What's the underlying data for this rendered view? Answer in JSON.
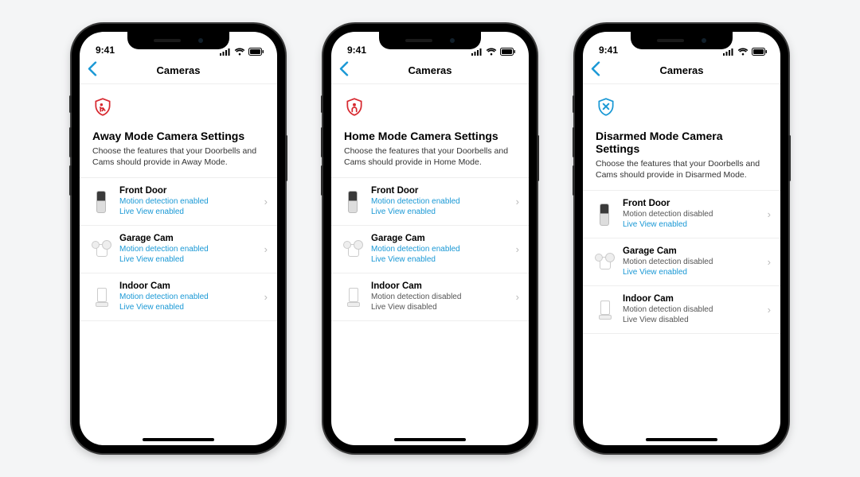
{
  "status": {
    "time": "9:41"
  },
  "nav": {
    "title": "Cameras"
  },
  "colors": {
    "accent": "#1998d5",
    "away": "#d7282f",
    "home": "#d7282f",
    "disarmed": "#1998d5"
  },
  "phones": [
    {
      "icon": "away",
      "title": "Away Mode Camera Settings",
      "desc": "Choose the features that your Doorbells and Cams should provide in Away Mode.",
      "devices": [
        {
          "name": "Front Door",
          "thumb": "doorbell",
          "motion": {
            "text": "Motion detection enabled",
            "on": true
          },
          "live": {
            "text": "Live View enabled",
            "on": true
          }
        },
        {
          "name": "Garage Cam",
          "thumb": "spotlight",
          "motion": {
            "text": "Motion detection enabled",
            "on": true
          },
          "live": {
            "text": "Live View enabled",
            "on": true
          }
        },
        {
          "name": "Indoor Cam",
          "thumb": "indoor",
          "motion": {
            "text": "Motion detection enabled",
            "on": true
          },
          "live": {
            "text": "Live View enabled",
            "on": true
          }
        }
      ]
    },
    {
      "icon": "home",
      "title": "Home Mode Camera Settings",
      "desc": "Choose the features that your Doorbells and Cams should provide in Home Mode.",
      "devices": [
        {
          "name": "Front Door",
          "thumb": "doorbell",
          "motion": {
            "text": "Motion detection enabled",
            "on": true
          },
          "live": {
            "text": "Live View enabled",
            "on": true
          }
        },
        {
          "name": "Garage Cam",
          "thumb": "spotlight",
          "motion": {
            "text": "Motion detection enabled",
            "on": true
          },
          "live": {
            "text": "Live View enabled",
            "on": true
          }
        },
        {
          "name": "Indoor Cam",
          "thumb": "indoor",
          "motion": {
            "text": "Motion detection disabled",
            "on": false
          },
          "live": {
            "text": "Live View disabled",
            "on": false
          }
        }
      ]
    },
    {
      "icon": "disarmed",
      "title": "Disarmed Mode Camera Settings",
      "desc": "Choose the features that your Doorbells and Cams should provide in Disarmed Mode.",
      "devices": [
        {
          "name": "Front Door",
          "thumb": "doorbell",
          "motion": {
            "text": "Motion detection disabled",
            "on": false
          },
          "live": {
            "text": "Live View enabled",
            "on": true
          }
        },
        {
          "name": "Garage Cam",
          "thumb": "spotlight",
          "motion": {
            "text": "Motion detection disabled",
            "on": false
          },
          "live": {
            "text": "Live View enabled",
            "on": true
          }
        },
        {
          "name": "Indoor Cam",
          "thumb": "indoor",
          "motion": {
            "text": "Motion detection disabled",
            "on": false
          },
          "live": {
            "text": "Live View disabled",
            "on": false
          }
        }
      ]
    }
  ]
}
